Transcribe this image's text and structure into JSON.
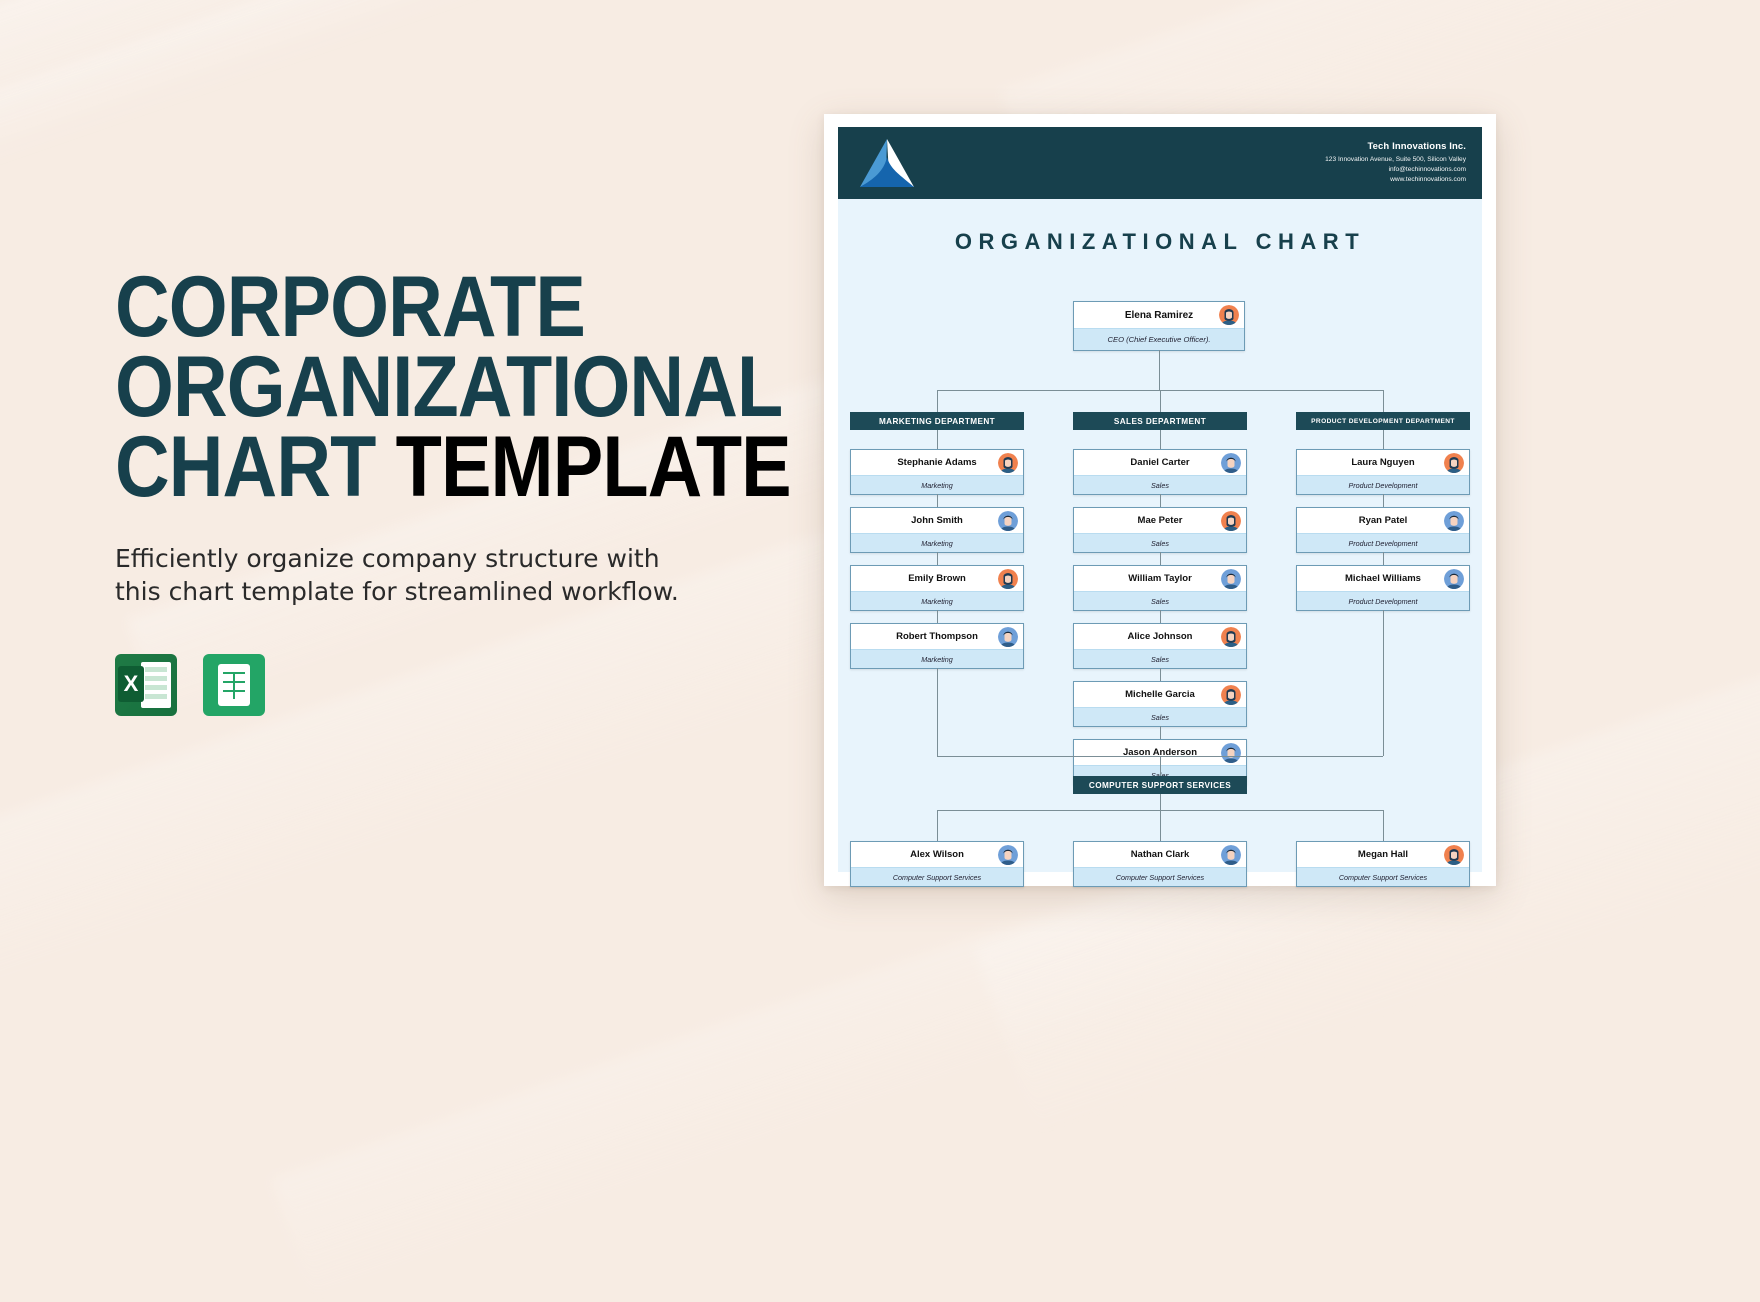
{
  "promo": {
    "title_line1": "CORPORATE",
    "title_line2": "ORGANIZATIONAL",
    "title_line3_teal": "CHART",
    "title_line3_black": "TEMPLATE",
    "description": "Efficiently organize company structure with this chart template for streamlined workflow.",
    "format_badges": [
      {
        "name": "excel-badge",
        "glyph": "X"
      },
      {
        "name": "google-sheets-badge",
        "glyph": ""
      }
    ],
    "colors": {
      "teal": "#17404c",
      "black": "#000000",
      "background": "#f7ece3"
    }
  },
  "document": {
    "header": {
      "logo_name": "tech-innovations-logo",
      "company_name": "Tech Innovations Inc.",
      "address": "123 Innovation Avenue, Suite 500, Silicon Valley",
      "email": "info@techinnovations.com",
      "website": "www.techinnovations.com",
      "bar_color": "#17404c"
    },
    "title": "ORGANIZATIONAL CHART",
    "colors": {
      "page_bg": "#e8f4fc",
      "node_border": "#6d9bb5",
      "role_bg": "#cfe8f7",
      "dept_bg": "#1d4a57",
      "connector": "#7b8e96"
    }
  },
  "chart_data": {
    "type": "diagram",
    "title": "ORGANIZATIONAL CHART",
    "root": {
      "name": "Elena Ramirez",
      "role": "CEO (Chief Executive Officer).",
      "gender": "female"
    },
    "departments": [
      {
        "label": "MARKETING DEPARTMENT",
        "members": [
          {
            "name": "Stephanie Adams",
            "role": "Marketing",
            "gender": "female"
          },
          {
            "name": "John Smith",
            "role": "Marketing",
            "gender": "male"
          },
          {
            "name": "Emily Brown",
            "role": "Marketing",
            "gender": "female"
          },
          {
            "name": "Robert Thompson",
            "role": "Marketing",
            "gender": "male"
          }
        ]
      },
      {
        "label": "SALES DEPARTMENT",
        "members": [
          {
            "name": "Daniel Carter",
            "role": "Sales",
            "gender": "male"
          },
          {
            "name": "Mae Peter",
            "role": "Sales",
            "gender": "female"
          },
          {
            "name": "William Taylor",
            "role": "Sales",
            "gender": "male"
          },
          {
            "name": "Alice Johnson",
            "role": "Sales",
            "gender": "female"
          },
          {
            "name": "Michelle Garcia",
            "role": "Sales",
            "gender": "female"
          },
          {
            "name": "Jason Anderson",
            "role": "Sales",
            "gender": "male"
          }
        ]
      },
      {
        "label": "PRODUCT DEVELOPMENT DEPARTMENT",
        "members": [
          {
            "name": "Laura Nguyen",
            "role": "Product Development",
            "gender": "female"
          },
          {
            "name": "Ryan Patel",
            "role": "Product Development",
            "gender": "male"
          },
          {
            "name": "Michael Williams",
            "role": "Product Development",
            "gender": "male"
          }
        ]
      }
    ],
    "support": {
      "label": "COMPUTER SUPPORT SERVICES",
      "members": [
        {
          "name": "Alex Wilson",
          "role": "Computer Support Services",
          "gender": "male"
        },
        {
          "name": "Nathan Clark",
          "role": "Computer Support Services",
          "gender": "male"
        },
        {
          "name": "Megan Hall",
          "role": "Computer Support Services",
          "gender": "female"
        }
      ]
    }
  }
}
